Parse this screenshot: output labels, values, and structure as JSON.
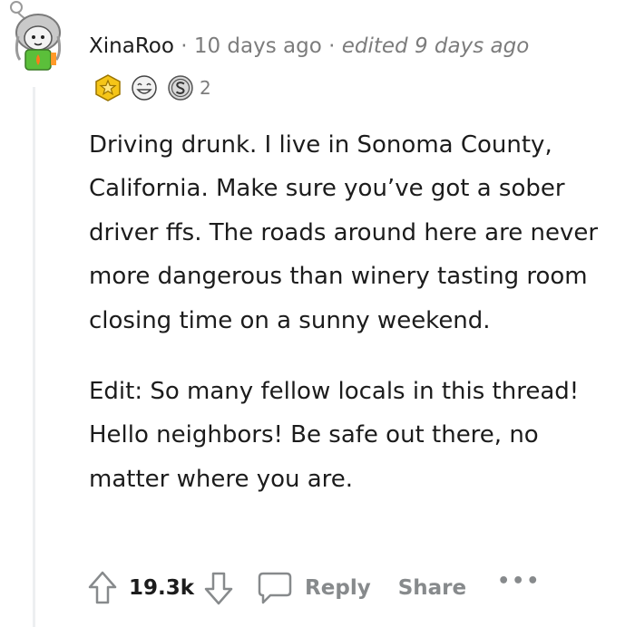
{
  "comment": {
    "username": "XinaRoo",
    "separator": "·",
    "timestamp": "10 days ago",
    "edited": "edited 9 days ago",
    "awards": [
      {
        "icon": "gold-star-award-icon"
      },
      {
        "icon": "laughing-face-award-icon"
      },
      {
        "icon": "silver-s-award-icon"
      }
    ],
    "award_count": "2",
    "paragraphs": [
      "Driving drunk. I live in Sonoma County, California. Make sure you’ve got a sober driver ffs. The roads around here are never more dangerous than winery tasting room closing time on a sunny weekend.",
      "Edit: So many fellow locals in this thread! Hello neighbors! Be safe out there, no matter where you are."
    ]
  },
  "actions": {
    "vote_count": "19.3k",
    "reply_label": "Reply",
    "share_label": "Share",
    "more_label": "•••"
  },
  "colors": {
    "text": "#1c1c1c",
    "meta": "#7c7c7c",
    "action": "#878a8c",
    "thread_line": "#edeff1"
  }
}
